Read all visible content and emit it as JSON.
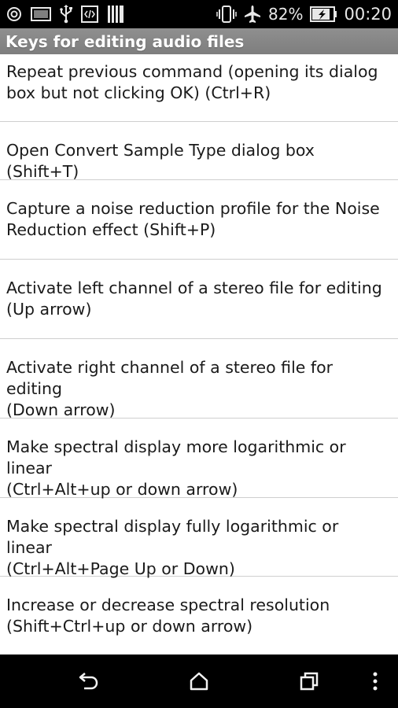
{
  "status_bar": {
    "battery_percent": "82%",
    "time": "00:20",
    "left_icons": [
      "compass-icon",
      "image-icon",
      "usb-icon",
      "code-icon",
      "sd-card-icon"
    ],
    "right_icons": [
      "vibrate-icon",
      "airplane-mode-icon",
      "battery-charging-icon"
    ]
  },
  "header": {
    "title": "Keys for editing audio files"
  },
  "list": {
    "items": [
      {
        "line1": "Repeat previous command (opening its dialog",
        "line2": "box but not clicking OK) (Ctrl+R)"
      },
      {
        "line1": "Open Convert Sample Type dialog box (Shift+T)",
        "line2": ""
      },
      {
        "line1": "Capture a noise reduction profile for the Noise",
        "line2": "Reduction effect (Shift+P)"
      },
      {
        "line1": "Activate left channel of a stereo file for editing",
        "line2": "(Up arrow)"
      },
      {
        "line1": "Activate right channel of a stereo file for editing",
        "line2": "(Down arrow)"
      },
      {
        "line1": "Make spectral display more logarithmic or linear",
        "line2": "(Ctrl+Alt+up or down arrow)"
      },
      {
        "line1": "Make spectral display fully logarithmic or linear",
        "line2": "(Ctrl+Alt+Page Up or Down)"
      },
      {
        "line1": "Increase or decrease spectral resolution",
        "line2": "(Shift+Ctrl+up or down arrow)"
      }
    ]
  },
  "nav_bar": {
    "icons": [
      "back-icon",
      "home-icon",
      "recent-apps-icon",
      "overflow-menu-icon"
    ]
  },
  "colors": {
    "status_bar_bg": "#000000",
    "title_bar_bg": "#888888",
    "list_bg": "#ffffff",
    "divider": "#cfcfcf",
    "nav_bar_bg": "#000000"
  }
}
